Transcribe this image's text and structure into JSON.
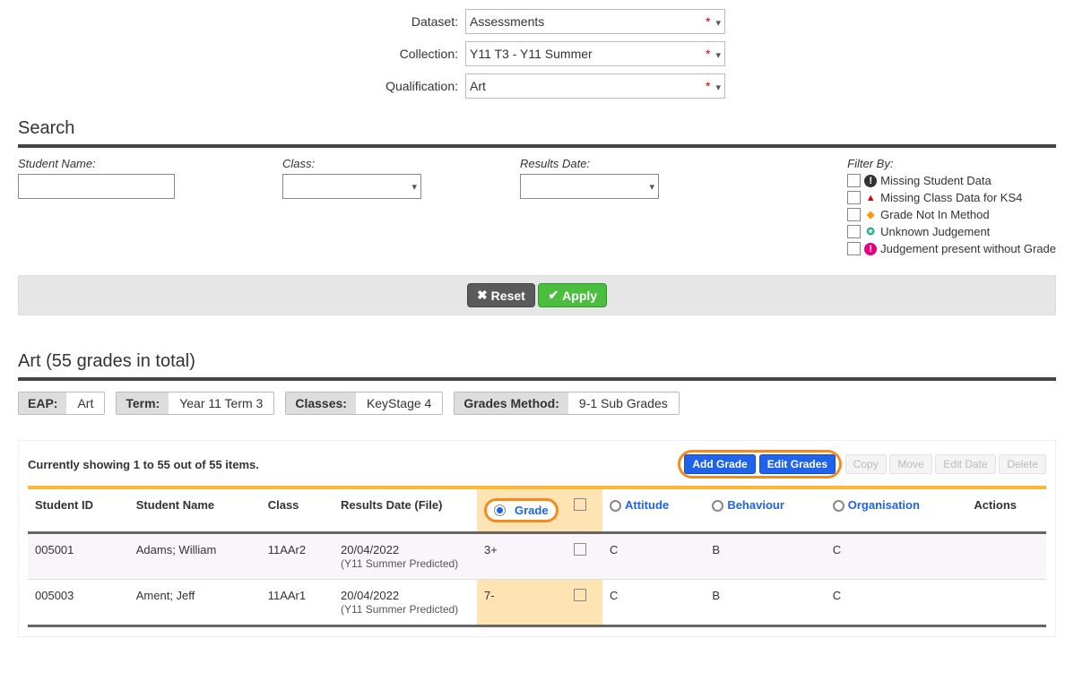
{
  "filters": {
    "dataset_label": "Dataset:",
    "dataset_value": "Assessments",
    "collection_label": "Collection:",
    "collection_value": "Y11 T3 - Y11 Summer",
    "qualification_label": "Qualification:",
    "qualification_value": "Art"
  },
  "search": {
    "heading": "Search",
    "student_name_label": "Student Name:",
    "class_label": "Class:",
    "results_date_label": "Results Date:",
    "filter_by_label": "Filter By:",
    "options": {
      "missing_student": "Missing Student Data",
      "missing_class": "Missing Class Data for KS4",
      "grade_not_in_method": "Grade Not In Method",
      "unknown_judgement": "Unknown Judgement",
      "judgement_no_grade": "Judgement present without Grade"
    },
    "reset_label": "Reset",
    "apply_label": "Apply"
  },
  "summary": {
    "title": "Art (55 grades in total)",
    "tags": {
      "eap_k": "EAP:",
      "eap_v": "Art",
      "term_k": "Term:",
      "term_v": "Year 11 Term 3",
      "classes_k": "Classes:",
      "classes_v": "KeyStage 4",
      "method_k": "Grades Method:",
      "method_v": "9-1 Sub Grades"
    }
  },
  "table": {
    "count_text": "Currently showing 1 to 55 out of 55 items.",
    "buttons": {
      "add_grade": "Add Grade",
      "edit_grades": "Edit Grades",
      "copy": "Copy",
      "move": "Move",
      "edit_date": "Edit Date",
      "delete": "Delete"
    },
    "headers": {
      "student_id": "Student ID",
      "student_name": "Student Name",
      "class": "Class",
      "results_date": "Results Date (File)",
      "grade": "Grade",
      "attitude": "Attitude",
      "behaviour": "Behaviour",
      "organisation": "Organisation",
      "actions": "Actions"
    },
    "rows": [
      {
        "id": "005001",
        "name": "Adams; William",
        "class": "11AAr2",
        "date": "20/04/2022",
        "file": "(Y11 Summer Predicted)",
        "grade": "3+",
        "attitude": "C",
        "behaviour": "B",
        "organisation": "C"
      },
      {
        "id": "005003",
        "name": "Ament; Jeff",
        "class": "11AAr1",
        "date": "20/04/2022",
        "file": "(Y11 Summer Predicted)",
        "grade": "7-",
        "attitude": "C",
        "behaviour": "B",
        "organisation": "C"
      }
    ]
  }
}
